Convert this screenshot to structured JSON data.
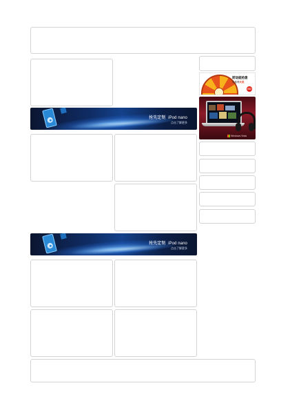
{
  "banners": [
    {
      "text": "抢先定制",
      "product": "iPod nano",
      "sub": "点击了解更多"
    },
    {
      "text": "抢先定制",
      "product": "iPod nano",
      "sub": "点击了解更多"
    }
  ],
  "wheel_ad": {
    "title": "转动就抢盘",
    "subtitle_prefix": "免费得",
    "subtitle_highlight": "大奖",
    "go_label": "GO"
  },
  "laptop_ad": {
    "brand": "Windows Vista"
  },
  "colors": {
    "panel_border": "#d3d3d3",
    "banner_dark": "#0b1530",
    "banner_blue": "#14418a",
    "wheel_orange": "#f7b21c",
    "wheel_red": "#e8531b",
    "laptop_bg": "#8b1a28"
  }
}
